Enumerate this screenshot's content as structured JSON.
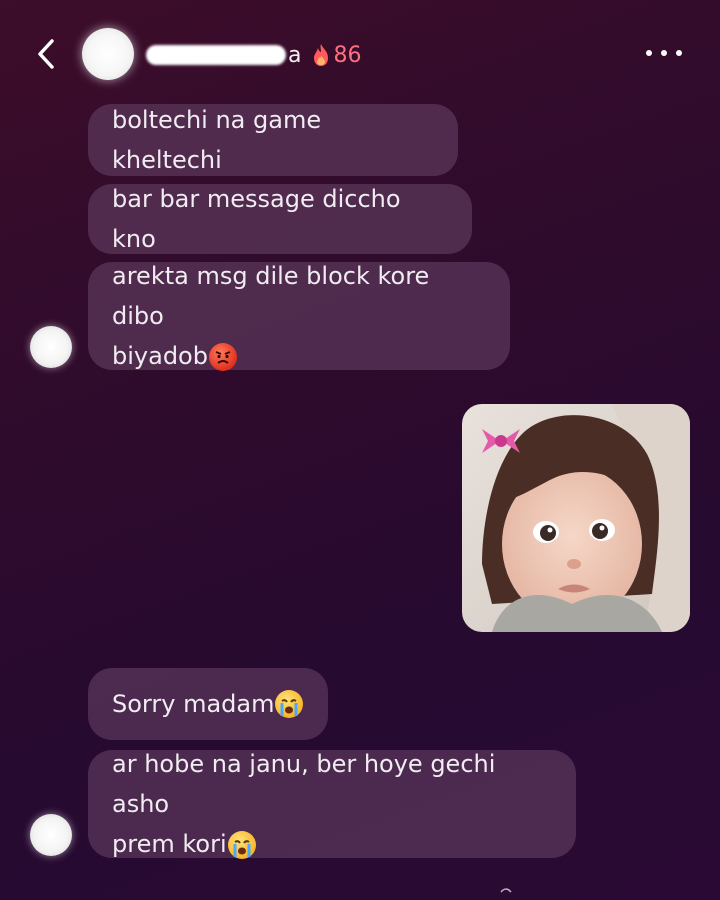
{
  "header": {
    "name_suffix": "a",
    "streak_count": "86"
  },
  "messages": [
    {
      "text": "boltechi na game kheltechi"
    },
    {
      "text": "bar bar message diccho kno"
    },
    {
      "line1": "arekta msg dile block kore dibo",
      "line2": "biyadob",
      "emoji": "angry-face-emoji"
    },
    {
      "text": "Sorry madam",
      "emoji": "crying-face-emoji"
    },
    {
      "line1": "ar hobe na janu, ber hoye gechi asho",
      "line2": "prem kori",
      "emoji": "crying-face-emoji"
    }
  ],
  "photo": {
    "description_icon": "photo-message"
  },
  "colors": {
    "background_top": "#3d0d2a",
    "background_bottom": "#2a0a34",
    "bubble": "#5c385c",
    "streak_text": "#ff6f7d"
  }
}
